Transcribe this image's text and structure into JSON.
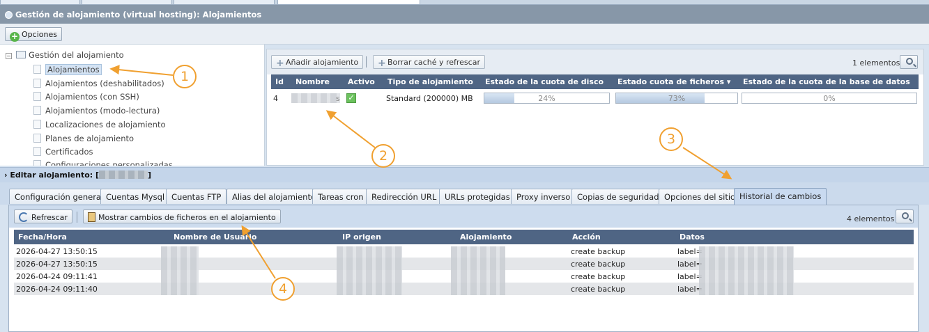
{
  "header": {
    "title": "Gestión de alojamiento (virtual hosting): Alojamientos"
  },
  "toolbar": {
    "options_label": "Opciones"
  },
  "tree": {
    "root_label": "Gestión del alojamiento",
    "root_toggle": "−",
    "items": [
      {
        "label": "Alojamientos"
      },
      {
        "label": "Alojamientos (deshabilitados)"
      },
      {
        "label": "Alojamientos (con SSH)"
      },
      {
        "label": "Alojamientos (modo-lectura)"
      },
      {
        "label": "Localizaciones de alojamiento"
      },
      {
        "label": "Planes de alojamiento"
      },
      {
        "label": "Certificados"
      },
      {
        "label": "Configuraciones personalizadas"
      }
    ]
  },
  "hosting": {
    "add_label": "Añadir alojamiento",
    "clear_cache_label": "Borrar caché y refrescar",
    "count_label": "1 elementos |",
    "columns": [
      "Id",
      "Nombre",
      "Activo",
      "Tipo de alojamiento",
      "Estado de la cuota de disco",
      "Estado cuota de ficheros ▾",
      "Estado de la cuota de la base de datos"
    ],
    "row": {
      "id": "4",
      "name_suffix": "s",
      "type": "Standard (200000) MB",
      "disk_pct": "24%",
      "disk_value": 0.24,
      "files_pct": "73%",
      "files_value": 0.73,
      "db_pct": "0%",
      "db_value": 0
    }
  },
  "edit": {
    "label": "Editar alojamiento: [",
    "label_end": "]"
  },
  "tabs": [
    {
      "label": "Configuración general"
    },
    {
      "label": "Cuentas Mysql"
    },
    {
      "label": "Cuentas FTP"
    },
    {
      "label": "Alias del alojamiento"
    },
    {
      "label": "Tareas cron"
    },
    {
      "label": "Redirección URL"
    },
    {
      "label": "URLs protegidas"
    },
    {
      "label": "Proxy inverso"
    },
    {
      "label": "Copias de seguridad"
    },
    {
      "label": "Opciones del sitio"
    },
    {
      "label": "Historial de cambios",
      "active": true
    }
  ],
  "history": {
    "refresh_label": "Refrescar",
    "show_changes_label": "Mostrar cambios de ficheros en el alojamiento",
    "count_label": "4 elementos |",
    "columns": [
      "Fecha/Hora",
      "Nombre de Usuario",
      "IP origen",
      "Alojamiento",
      "Acción",
      "Datos"
    ],
    "rows": [
      {
        "date": "2026-04-27 13:50:15",
        "action": "create backup",
        "data": "label="
      },
      {
        "date": "2026-04-27 13:50:15",
        "action": "create backup",
        "data": "label="
      },
      {
        "date": "2026-04-24 09:11:41",
        "action": "create backup",
        "data": "label="
      },
      {
        "date": "2026-04-24 09:11:40",
        "action": "create backup",
        "data": "label="
      }
    ]
  },
  "annotations": [
    "1",
    "2",
    "3",
    "4"
  ],
  "colors": {
    "accent": "#f0a030",
    "header_bg": "#8797a8",
    "grid_header": "#4f6584"
  }
}
